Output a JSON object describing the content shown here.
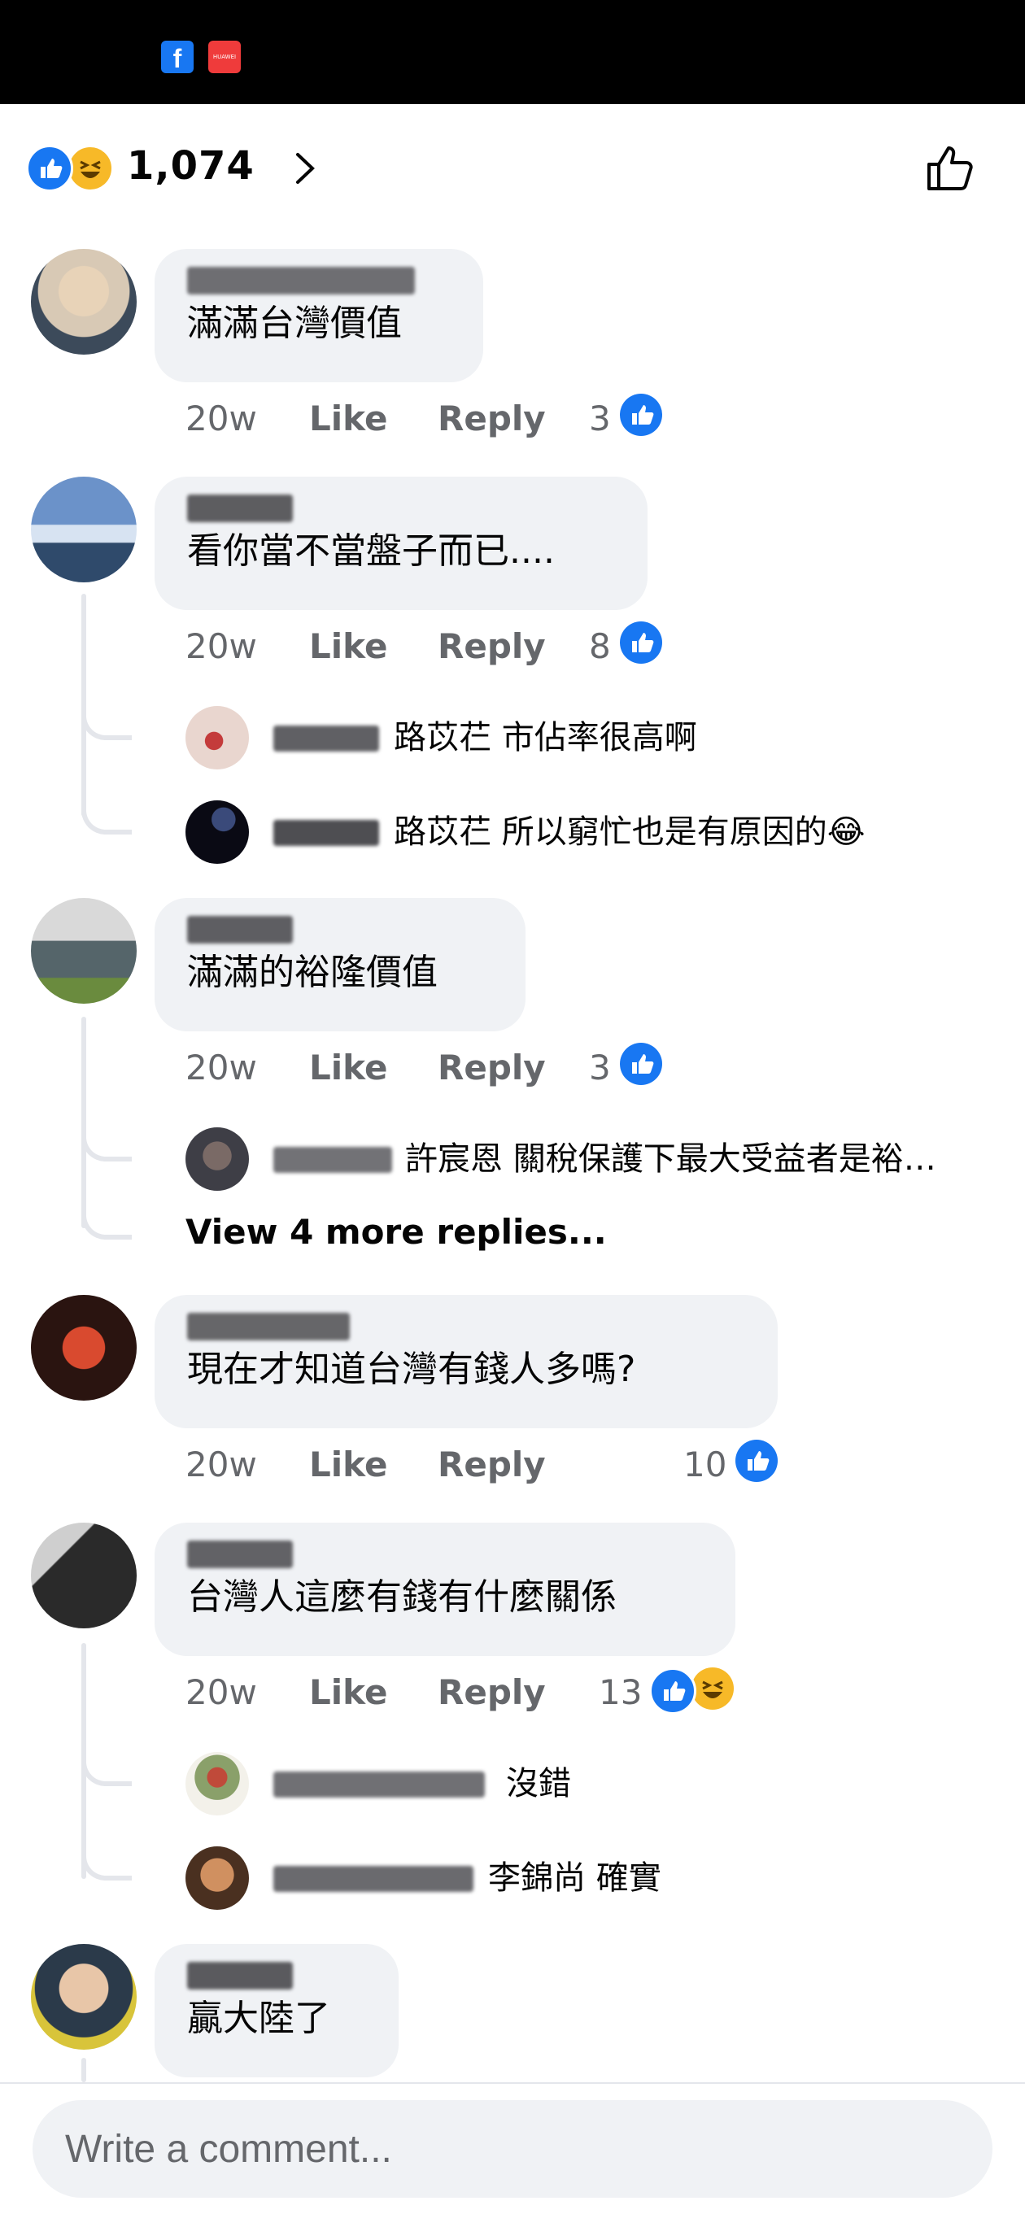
{
  "status_bar": {
    "apps": [
      "facebook-icon",
      "huawei-icon"
    ]
  },
  "reactions": {
    "count": "1,074",
    "types": [
      "like",
      "haha"
    ]
  },
  "comments": [
    {
      "author": "Lingshin Lin",
      "text": "滿滿台灣價值",
      "time": "20w",
      "like_label": "Like",
      "reply_label": "Reply",
      "reaction_count": "3",
      "reactions": [
        "like"
      ]
    },
    {
      "author": "蔡明芷",
      "text": "看你當不當盤子而已....",
      "time": "20w",
      "like_label": "Like",
      "reply_label": "Reply",
      "reaction_count": "8",
      "reactions": [
        "like"
      ],
      "replies": [
        {
          "author": "黃美瑪",
          "text": "路苡芢 市佔率很高啊"
        },
        {
          "author": "劉文匯",
          "text": "路苡芢 所以窮忙也是有原因的😂"
        }
      ]
    },
    {
      "author": "林國凱",
      "text": "滿滿的裕隆價值",
      "time": "20w",
      "like_label": "Like",
      "reply_label": "Reply",
      "reaction_count": "3",
      "reactions": [
        "like"
      ],
      "replies": [
        {
          "author": "Ting H",
          "text": "許宸恩 關稅保護下最大受益者是裕…"
        }
      ],
      "view_more": "View 4 more replies..."
    },
    {
      "author": "Luke Zou",
      "text": "現在才知道台灣有錢人多嗎?",
      "time": "20w",
      "like_label": "Like",
      "reply_label": "Reply",
      "reaction_count": "10",
      "reactions": [
        "like"
      ]
    },
    {
      "author": "李錦尚",
      "text": "台灣人這麼有錢有什麼關係",
      "time": "20w",
      "like_label": "Like",
      "reply_label": "Reply",
      "reaction_count": "13",
      "reactions": [
        "like",
        "haha"
      ],
      "replies": [
        {
          "author": "黃慧萍 劉美玲",
          "text": "沒錯"
        },
        {
          "author": "Andy Wang",
          "text": "李錦尚 確實"
        }
      ]
    },
    {
      "author": "陳俊偉",
      "text": "贏大陸了"
    }
  ],
  "composer": {
    "placeholder": "Write a comment..."
  },
  "colors": {
    "accent": "#1877f2",
    "bubble": "#f0f2f5",
    "muted": "#65676b",
    "haha": "#f7b928"
  }
}
